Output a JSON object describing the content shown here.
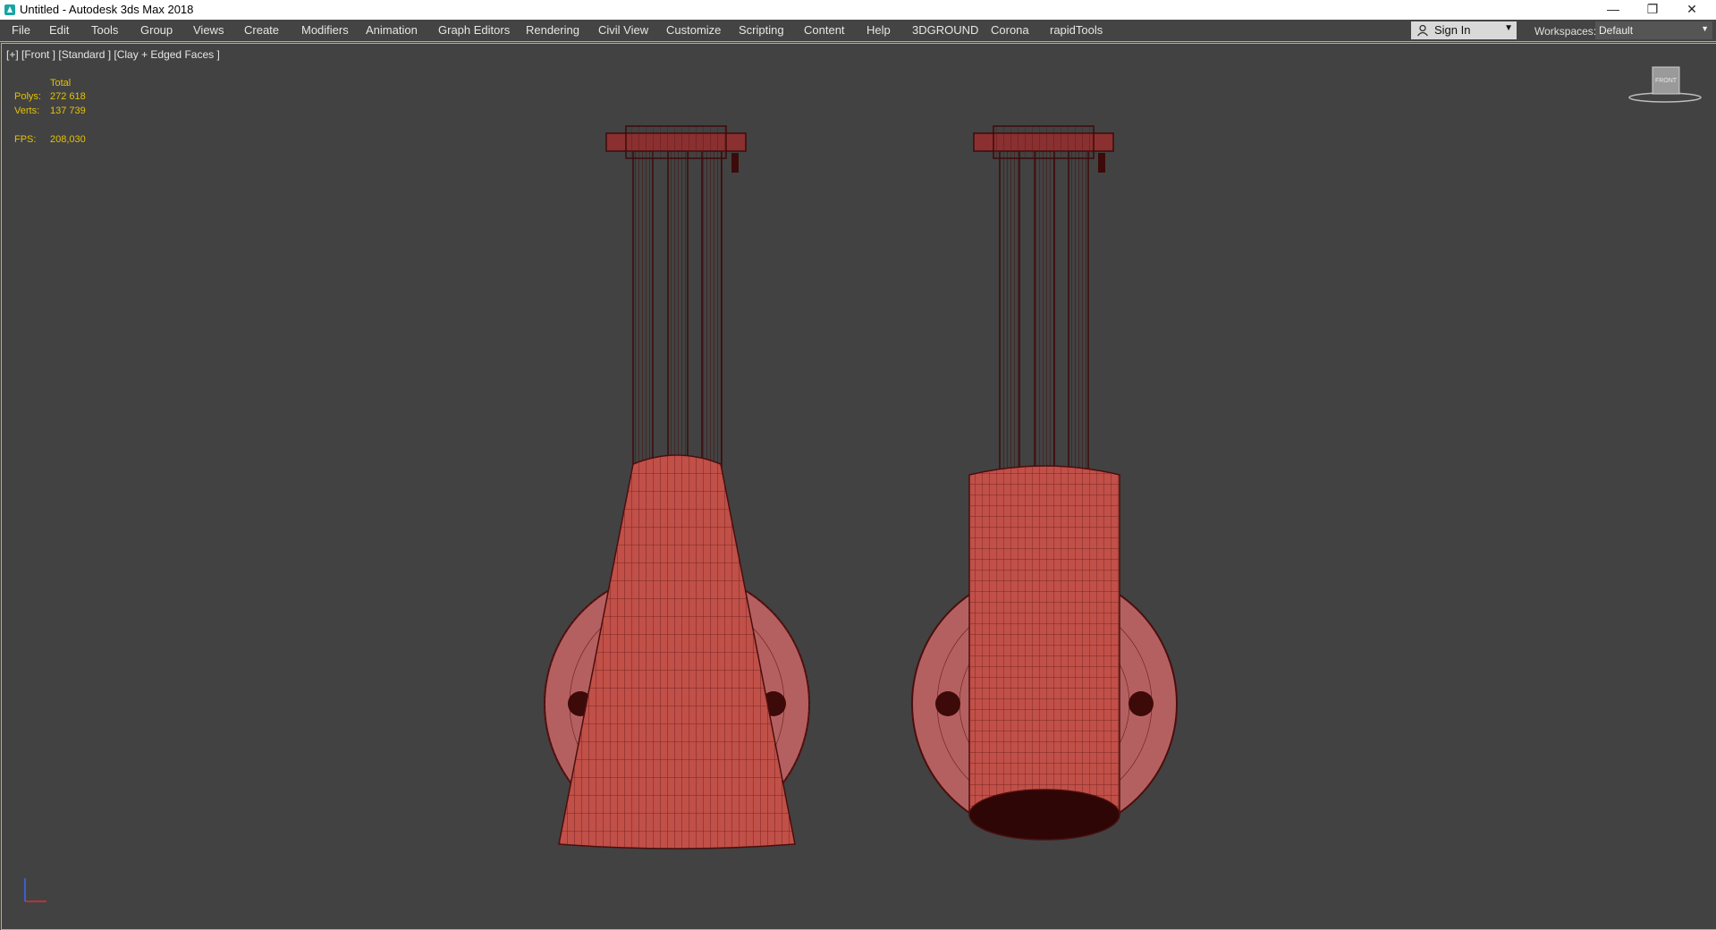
{
  "window": {
    "title": "Untitled - Autodesk 3ds Max 2018",
    "icons": {
      "app": "3dsmax-app-icon",
      "minimize": "minimize-icon",
      "restore": "restore-icon",
      "close": "close-icon"
    }
  },
  "menu": {
    "items": [
      "File",
      "Edit",
      "Tools",
      "Group",
      "Views",
      "Create",
      "Modifiers",
      "Animation",
      "Graph Editors",
      "Rendering",
      "Civil View",
      "Customize",
      "Scripting",
      "Content",
      "Help",
      "3DGROUND",
      "Corona",
      "rapidTools"
    ],
    "sign_in": "Sign In",
    "workspaces_label": "Workspaces:",
    "workspace_value": "Default"
  },
  "viewport": {
    "label": "[+] [Front ] [Standard ] [Clay + Edged Faces ]",
    "stats": {
      "total": "Total",
      "polys_label": "Polys:",
      "polys": "272 618",
      "verts_label": "Verts:",
      "verts": "137 739",
      "fps_label": "FPS:",
      "fps": "208,030"
    },
    "viewcube_label": "FRONT"
  },
  "colors": {
    "viewport_bg": "#424242",
    "mesh_fill": "#c05048",
    "wire": "#5a1414",
    "stats_text": "#e5c200",
    "active_border": "#d4aa44"
  }
}
